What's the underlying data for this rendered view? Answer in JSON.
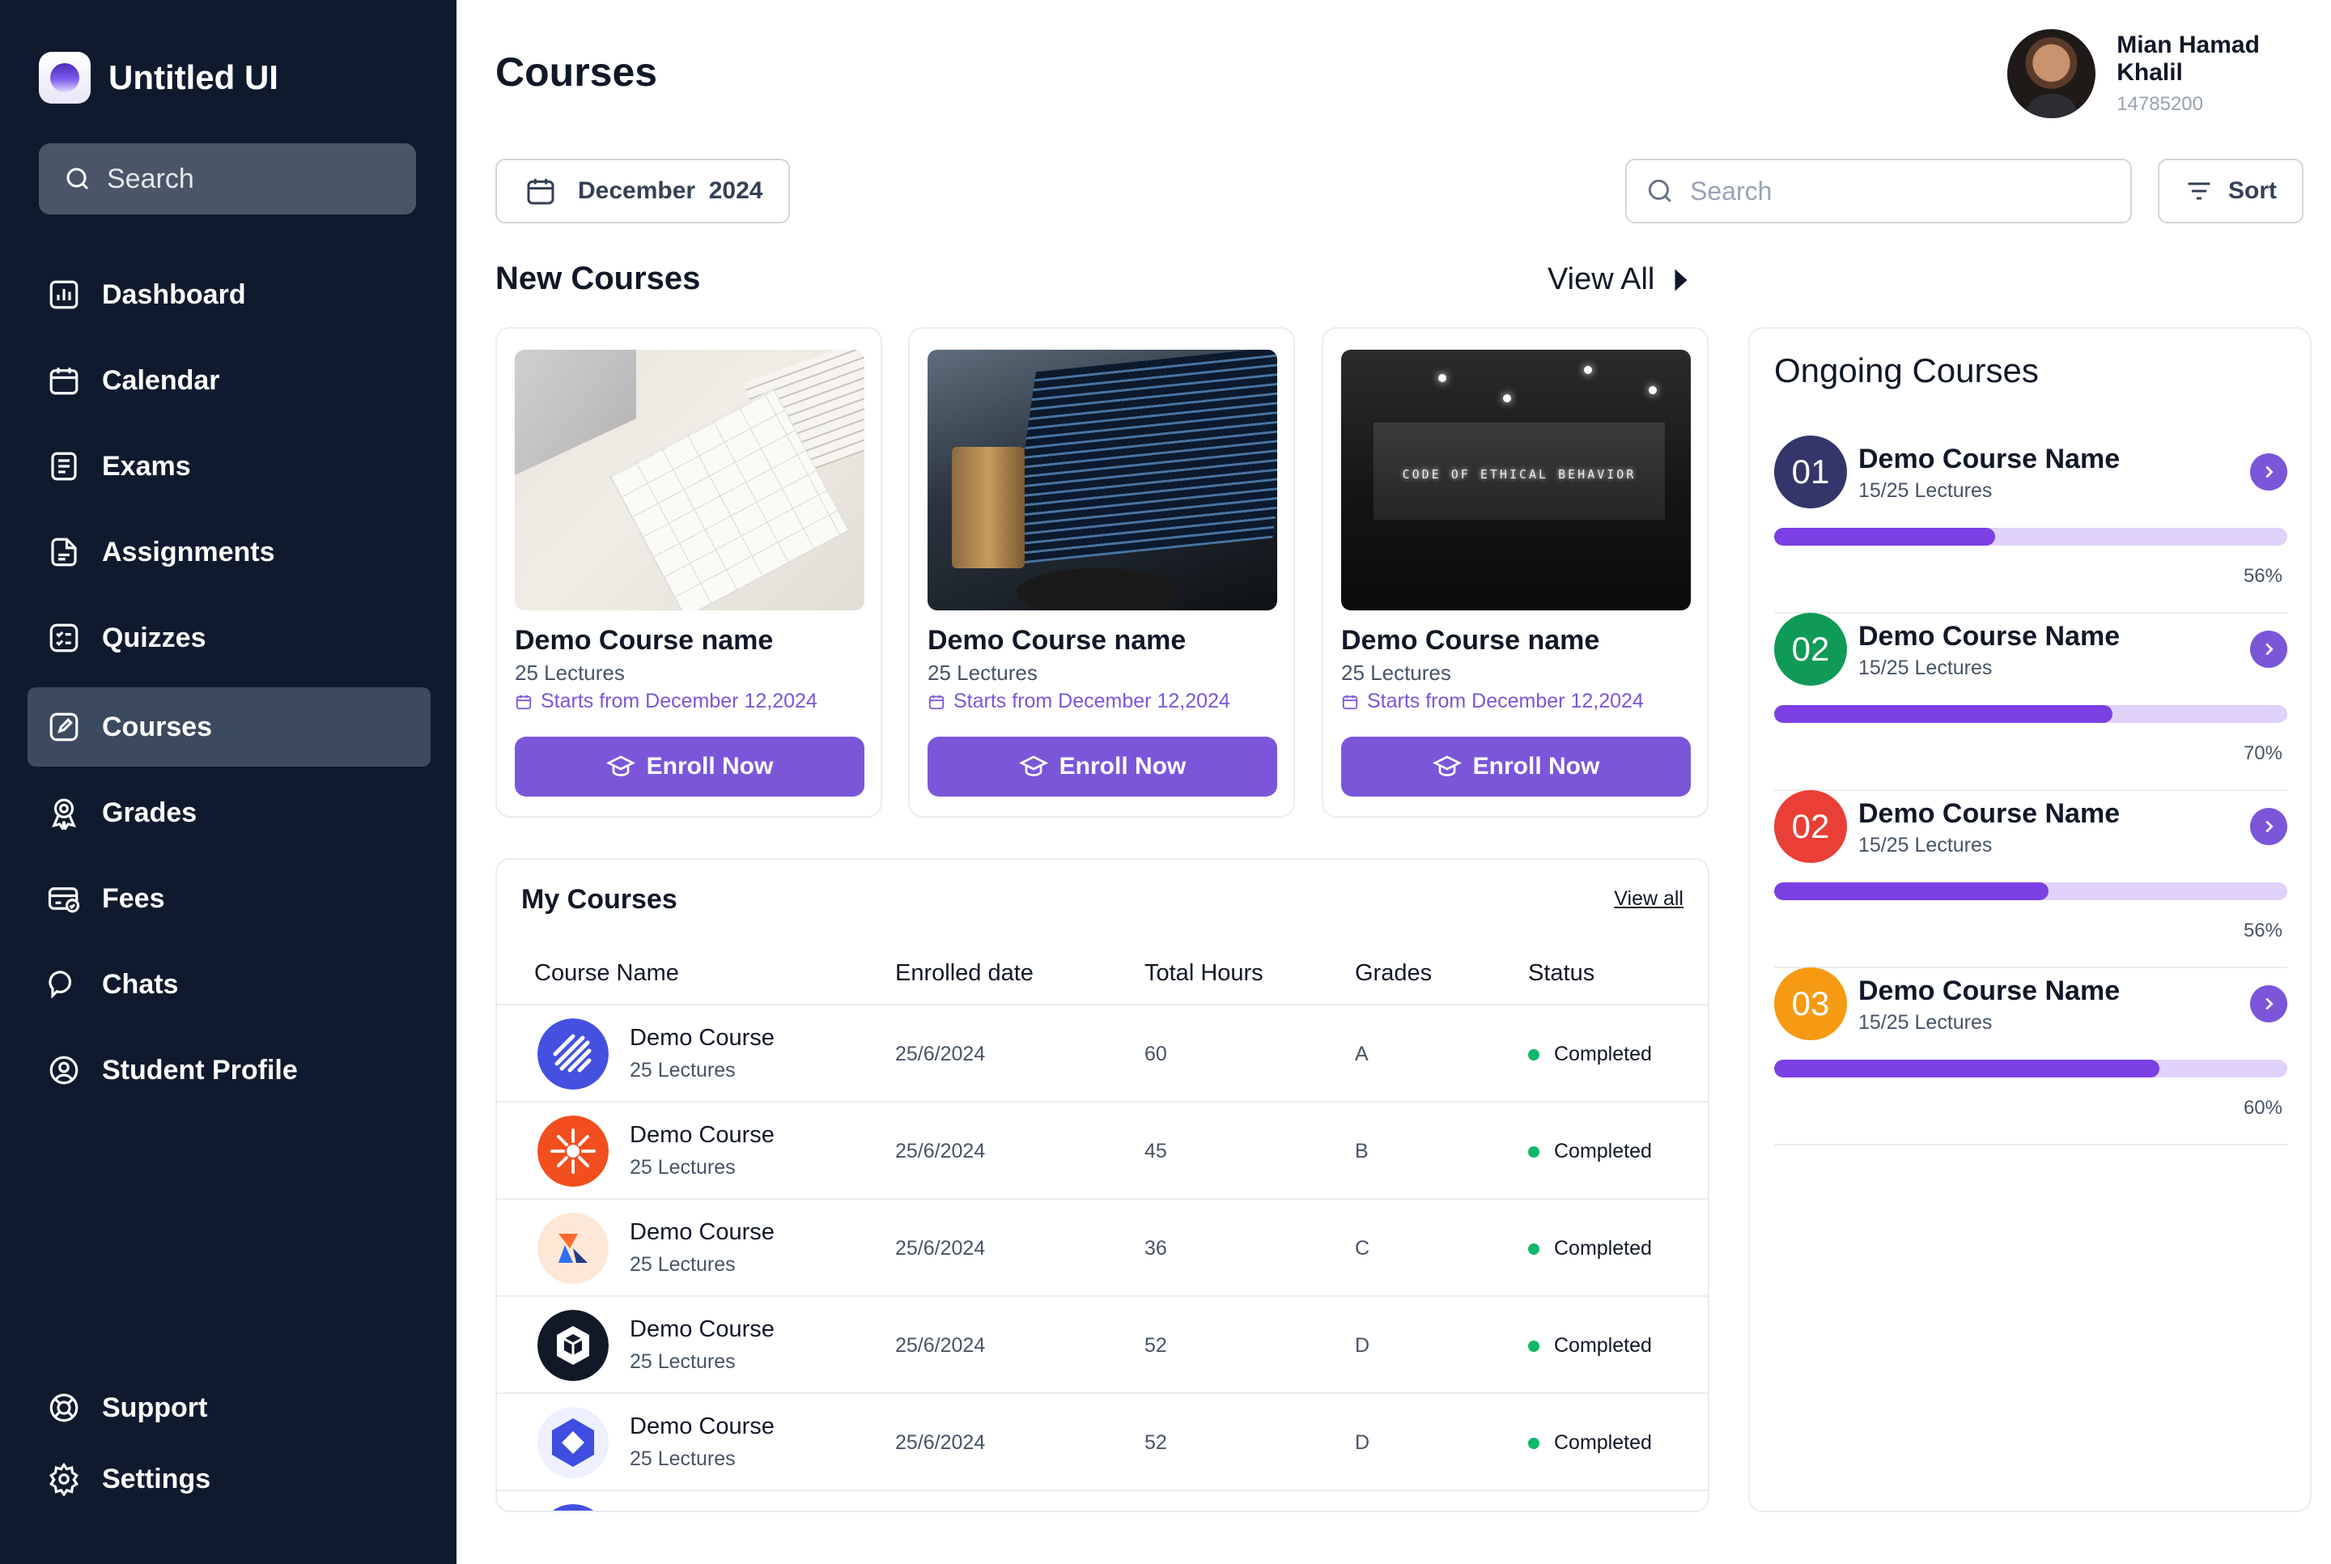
{
  "brand": {
    "name": "Untitled UI"
  },
  "sidebar": {
    "search_placeholder": "Search",
    "nav": [
      {
        "label": "Dashboard",
        "icon": "bar-chart-icon"
      },
      {
        "label": "Calendar",
        "icon": "calendar-icon"
      },
      {
        "label": "Exams",
        "icon": "document-icon"
      },
      {
        "label": "Assignments",
        "icon": "file-edit-icon"
      },
      {
        "label": "Quizzes",
        "icon": "checklist-icon"
      },
      {
        "label": "Courses",
        "icon": "edit-square-icon",
        "active": true
      },
      {
        "label": "Grades",
        "icon": "award-icon"
      },
      {
        "label": "Fees",
        "icon": "card-check-icon"
      },
      {
        "label": "Chats",
        "icon": "chat-bubbles-icon"
      },
      {
        "label": "Student Profile",
        "icon": "user-circle-icon"
      }
    ],
    "footer": [
      {
        "label": "Support",
        "icon": "lifebuoy-icon"
      },
      {
        "label": "Settings",
        "icon": "gear-icon"
      }
    ]
  },
  "header": {
    "title": "Courses",
    "user": {
      "name": "Mian Hamad Khalil",
      "id": "14785200"
    },
    "date_filter": "December  2024",
    "search_placeholder": "Search",
    "sort_label": "Sort"
  },
  "new_courses": {
    "title": "New Courses",
    "view_all": "View All",
    "cards": [
      {
        "name": "Demo Course name",
        "lectures": "25 Lectures",
        "start": "Starts from December 12,2024",
        "button": "Enroll Now"
      },
      {
        "name": "Demo Course name",
        "lectures": "25 Lectures",
        "start": "Starts from December 12,2024",
        "button": "Enroll Now"
      },
      {
        "name": "Demo Course name",
        "lectures": "25 Lectures",
        "start": "Starts from December 12,2024",
        "button": "Enroll Now",
        "image_text": "CODE OF ETHICAL BEHAVIOR"
      }
    ]
  },
  "my_courses": {
    "title": "My Courses",
    "view_all": "View all",
    "columns": [
      "Course Name",
      "Enrolled date",
      "Total Hours",
      "Grades",
      "Status"
    ],
    "rows": [
      {
        "name": "Demo Course",
        "lectures": "25 Lectures",
        "date": "25/6/2024",
        "hours": "60",
        "grade": "A",
        "status": "Completed"
      },
      {
        "name": "Demo Course",
        "lectures": "25 Lectures",
        "date": "25/6/2024",
        "hours": "45",
        "grade": "B",
        "status": "Completed"
      },
      {
        "name": "Demo Course",
        "lectures": "25 Lectures",
        "date": "25/6/2024",
        "hours": "36",
        "grade": "C",
        "status": "Completed"
      },
      {
        "name": "Demo Course",
        "lectures": "25 Lectures",
        "date": "25/6/2024",
        "hours": "52",
        "grade": "D",
        "status": "Completed"
      },
      {
        "name": "Demo Course",
        "lectures": "25 Lectures",
        "date": "25/6/2024",
        "hours": "52",
        "grade": "D",
        "status": "Completed"
      }
    ]
  },
  "ongoing": {
    "title": "Ongoing Courses",
    "items": [
      {
        "num": "01",
        "color": "#33356b",
        "name": "Demo Course Name",
        "lectures": "15/25 Lectures",
        "progress": 0.43,
        "pct": "56%"
      },
      {
        "num": "02",
        "color": "#109a57",
        "name": "Demo Course Name",
        "lectures": "15/25 Lectures",
        "progress": 0.66,
        "pct": "70%"
      },
      {
        "num": "02",
        "color": "#ea3f36",
        "name": "Demo Course Name",
        "lectures": "15/25 Lectures",
        "progress": 0.535,
        "pct": "56%"
      },
      {
        "num": "03",
        "color": "#f59a12",
        "name": "Demo Course Name",
        "lectures": "15/25 Lectures",
        "progress": 0.75,
        "pct": "60%"
      }
    ]
  },
  "colors": {
    "sidebar": "#101a2e",
    "accent": "#7b56d9",
    "success": "#12b76a"
  }
}
